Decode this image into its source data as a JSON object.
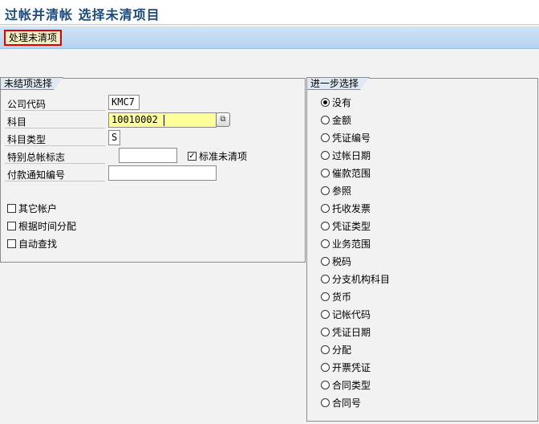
{
  "window": {
    "title": "过帐并清帐 选择未清项目"
  },
  "toolbar": {
    "process_open_items": "处理未清项"
  },
  "open_item_selection": {
    "tab_title": "未结项选择",
    "fields": [
      {
        "label": "公司代码",
        "value": "KMC7"
      },
      {
        "label": "科目",
        "value": "10010002"
      },
      {
        "label": "科目类型",
        "value": "S"
      },
      {
        "label": "特别总帐标志",
        "value": ""
      },
      {
        "label": "付款通知编号",
        "value": ""
      }
    ],
    "standard_open_items": {
      "label": "标准未清项",
      "checked": true
    },
    "checkboxes": [
      {
        "label": "其它帐户",
        "checked": false
      },
      {
        "label": "根据时间分配",
        "checked": false
      },
      {
        "label": "自动查找",
        "checked": false
      }
    ]
  },
  "further_selection": {
    "tab_title": "进一步选择",
    "selected_index": 0,
    "options": [
      "没有",
      "金额",
      "凭证编号",
      "过帐日期",
      "催款范围",
      "参照",
      "托收发票",
      "凭证类型",
      "业务范围",
      "税码",
      "分支机构科目",
      "货币",
      "记帐代码",
      "凭证日期",
      "分配",
      "开票凭证",
      "合同类型",
      "合同号"
    ]
  },
  "icons": {
    "search_help": "f4-help-icon",
    "check_mark": "✓"
  }
}
